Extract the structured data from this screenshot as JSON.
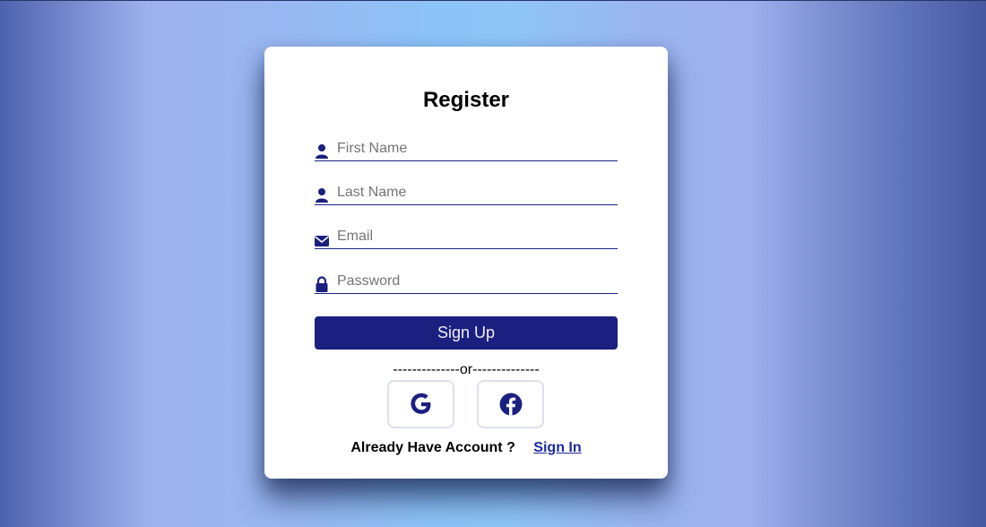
{
  "form": {
    "title": "Register",
    "fields": [
      {
        "icon": "user-icon",
        "placeholder": "First Name"
      },
      {
        "icon": "user-icon",
        "placeholder": "Last Name"
      },
      {
        "icon": "envelope-icon",
        "placeholder": "Email"
      },
      {
        "icon": "lock-icon",
        "placeholder": "Password"
      }
    ],
    "submit_label": "Sign Up",
    "divider_text": "--------------or--------------",
    "social": [
      {
        "name": "google",
        "icon": "google-icon"
      },
      {
        "name": "facebook",
        "icon": "facebook-icon"
      }
    ],
    "footer_text": "Already Have Account ?",
    "signin_label": "Sign In"
  },
  "colors": {
    "accent": "#1a1f80",
    "card": "#ffffff",
    "link": "#1a2a9a"
  }
}
